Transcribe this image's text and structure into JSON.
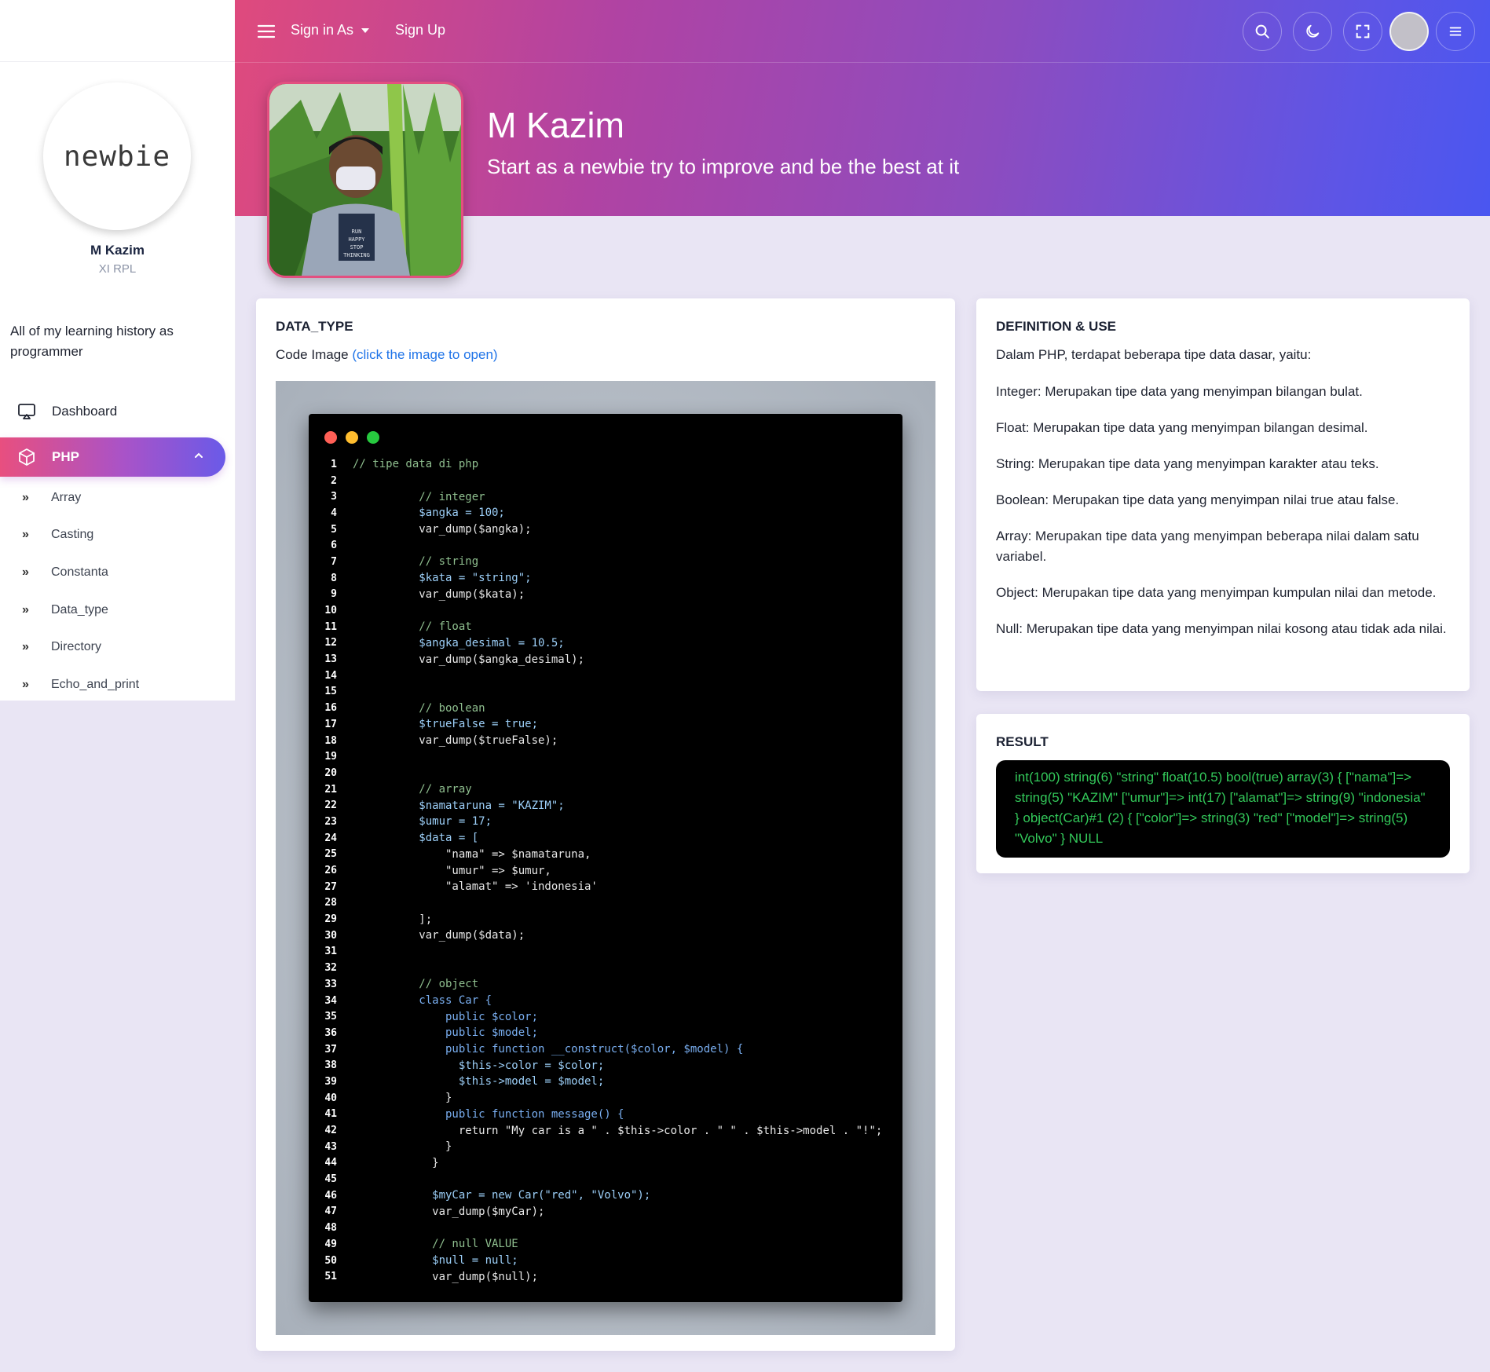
{
  "sidebar": {
    "logo_text": "newbie",
    "profile_name": "M Kazim",
    "profile_class": "XI RPL",
    "description": "All of my learning history as programmer",
    "dashboard_label": "Dashboard",
    "php_label": "PHP",
    "sub_items": [
      "Array",
      "Casting",
      "Constanta",
      "Data_type",
      "Directory",
      "Echo_and_print"
    ]
  },
  "topbar": {
    "sign_in_label": "Sign in As",
    "sign_up_label": "Sign Up"
  },
  "hero": {
    "name": "M Kazim",
    "tagline": "Start as a newbie try to improve and be the best at it",
    "shirt_text": "RUN HAPPY STOP THINKING"
  },
  "data_card": {
    "title": "DATA_TYPE",
    "caption": "Code Image",
    "caption_link": "(click the image to open)"
  },
  "code_lines": [
    {
      "n": "1",
      "t": "// tipe data di php",
      "k": "cm"
    },
    {
      "n": "2",
      "t": "",
      "k": "tx"
    },
    {
      "n": "3",
      "t": "          // integer",
      "k": "cm"
    },
    {
      "n": "4",
      "t": "          $angka = 100;",
      "k": "vr"
    },
    {
      "n": "5",
      "t": "          var_dump($angka);",
      "k": "tx"
    },
    {
      "n": "6",
      "t": "",
      "k": "tx"
    },
    {
      "n": "7",
      "t": "          // string",
      "k": "cm"
    },
    {
      "n": "8",
      "t": "          $kata = \"string\";",
      "k": "vr"
    },
    {
      "n": "9",
      "t": "          var_dump($kata);",
      "k": "tx"
    },
    {
      "n": "10",
      "t": "",
      "k": "tx"
    },
    {
      "n": "11",
      "t": "          // float",
      "k": "cm"
    },
    {
      "n": "12",
      "t": "          $angka_desimal = 10.5;",
      "k": "vr"
    },
    {
      "n": "13",
      "t": "          var_dump($angka_desimal);",
      "k": "tx"
    },
    {
      "n": "14",
      "t": "",
      "k": "tx"
    },
    {
      "n": "15",
      "t": "",
      "k": "tx"
    },
    {
      "n": "16",
      "t": "          // boolean",
      "k": "cm"
    },
    {
      "n": "17",
      "t": "          $trueFalse = true;",
      "k": "vr"
    },
    {
      "n": "18",
      "t": "          var_dump($trueFalse);",
      "k": "tx"
    },
    {
      "n": "19",
      "t": "",
      "k": "tx"
    },
    {
      "n": "20",
      "t": "",
      "k": "tx"
    },
    {
      "n": "21",
      "t": "          // array",
      "k": "cm"
    },
    {
      "n": "22",
      "t": "          $namataruna = \"KAZIM\";",
      "k": "vr"
    },
    {
      "n": "23",
      "t": "          $umur = 17;",
      "k": "vr"
    },
    {
      "n": "24",
      "t": "          $data = [",
      "k": "vr"
    },
    {
      "n": "25",
      "t": "              \"nama\" => $namataruna,",
      "k": "tx"
    },
    {
      "n": "26",
      "t": "              \"umur\" => $umur,",
      "k": "tx"
    },
    {
      "n": "27",
      "t": "              \"alamat\" => 'indonesia'",
      "k": "tx"
    },
    {
      "n": "28",
      "t": "",
      "k": "tx"
    },
    {
      "n": "29",
      "t": "          ];",
      "k": "tx"
    },
    {
      "n": "30",
      "t": "          var_dump($data);",
      "k": "tx"
    },
    {
      "n": "31",
      "t": "",
      "k": "tx"
    },
    {
      "n": "32",
      "t": "",
      "k": "tx"
    },
    {
      "n": "33",
      "t": "          // object",
      "k": "cm"
    },
    {
      "n": "34",
      "t": "          class Car {",
      "k": "kw"
    },
    {
      "n": "35",
      "t": "              public $color;",
      "k": "kw"
    },
    {
      "n": "36",
      "t": "              public $model;",
      "k": "kw"
    },
    {
      "n": "37",
      "t": "              public function __construct($color, $model) {",
      "k": "kw"
    },
    {
      "n": "38",
      "t": "                $this->color = $color;",
      "k": "vr"
    },
    {
      "n": "39",
      "t": "                $this->model = $model;",
      "k": "vr"
    },
    {
      "n": "40",
      "t": "              }",
      "k": "tx"
    },
    {
      "n": "41",
      "t": "              public function message() {",
      "k": "kw"
    },
    {
      "n": "42",
      "t": "                return \"My car is a \" . $this->color . \" \" . $this->model . \"!\";",
      "k": "tx"
    },
    {
      "n": "43",
      "t": "              }",
      "k": "tx"
    },
    {
      "n": "44",
      "t": "            }",
      "k": "tx"
    },
    {
      "n": "45",
      "t": "",
      "k": "tx"
    },
    {
      "n": "46",
      "t": "            $myCar = new Car(\"red\", \"Volvo\");",
      "k": "vr"
    },
    {
      "n": "47",
      "t": "            var_dump($myCar);",
      "k": "tx"
    },
    {
      "n": "48",
      "t": "",
      "k": "tx"
    },
    {
      "n": "49",
      "t": "            // null VALUE",
      "k": "cm"
    },
    {
      "n": "50",
      "t": "            $null = null;",
      "k": "vr"
    },
    {
      "n": "51",
      "t": "            var_dump($null);",
      "k": "tx"
    }
  ],
  "definition_card": {
    "title": "DEFINITION & USE",
    "intro": "Dalam PHP, terdapat beberapa tipe data dasar, yaitu:",
    "items": [
      "Integer: Merupakan tipe data yang menyimpan bilangan bulat.",
      "Float: Merupakan tipe data yang menyimpan bilangan desimal.",
      "String: Merupakan tipe data yang menyimpan karakter atau teks.",
      "Boolean: Merupakan tipe data yang menyimpan nilai true atau false.",
      "Array: Merupakan tipe data yang menyimpan beberapa nilai dalam satu variabel.",
      "Object: Merupakan tipe data yang menyimpan kumpulan nilai dan metode.",
      "Null: Merupakan tipe data yang menyimpan nilai kosong atau tidak ada nilai."
    ]
  },
  "result_card": {
    "title": "RESULT",
    "output": "int(100) string(6) \"string\" float(10.5) bool(true) array(3) { [\"nama\"]=> string(5) \"KAZIM\" [\"umur\"]=> int(17) [\"alamat\"]=> string(9) \"indonesia\" } object(Car)#1 (2) { [\"color\"]=> string(3) \"red\" [\"model\"]=> string(5) \"Volvo\" } NULL"
  },
  "colors": {
    "accent_pink": "#e84f7f",
    "accent_purple": "#8d4cbf",
    "accent_blue": "#4a56f0",
    "link_blue": "#1e73e8",
    "result_green": "#33c95a",
    "dot_red": "#ff5f56",
    "dot_yellow": "#ffbd2e",
    "dot_green": "#27c93f"
  }
}
